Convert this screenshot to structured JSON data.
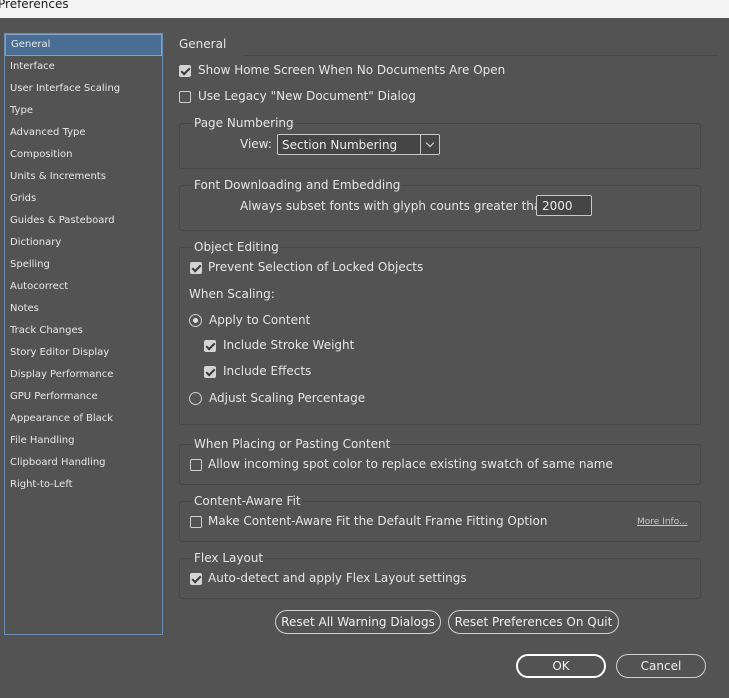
{
  "window": {
    "title": "Preferences"
  },
  "sidebar": {
    "items": [
      {
        "label": "General"
      },
      {
        "label": "Interface"
      },
      {
        "label": "User Interface Scaling"
      },
      {
        "label": "Type"
      },
      {
        "label": "Advanced Type"
      },
      {
        "label": "Composition"
      },
      {
        "label": "Units & Increments"
      },
      {
        "label": "Grids"
      },
      {
        "label": "Guides & Pasteboard"
      },
      {
        "label": "Dictionary"
      },
      {
        "label": "Spelling"
      },
      {
        "label": "Autocorrect"
      },
      {
        "label": "Notes"
      },
      {
        "label": "Track Changes"
      },
      {
        "label": "Story Editor Display"
      },
      {
        "label": "Display Performance"
      },
      {
        "label": "GPU Performance"
      },
      {
        "label": "Appearance of Black"
      },
      {
        "label": "File Handling"
      },
      {
        "label": "Clipboard Handling"
      },
      {
        "label": "Right-to-Left"
      }
    ],
    "selected": "General"
  },
  "main": {
    "title": "General",
    "show_home_screen": {
      "label": "Show Home Screen When No Documents Are Open",
      "checked": true
    },
    "legacy_new_doc": {
      "label": "Use Legacy \"New Document\" Dialog",
      "checked": false
    },
    "page_numbering": {
      "heading": "Page Numbering",
      "view_label": "View:",
      "view_value": "Section Numbering"
    },
    "font_downloading": {
      "heading": "Font Downloading and Embedding",
      "subset_label": "Always subset fonts with glyph counts greater than:",
      "subset_value": "2000"
    },
    "object_editing": {
      "heading": "Object Editing",
      "prevent_locked": {
        "label": "Prevent Selection of Locked Objects",
        "checked": true
      },
      "when_scaling_label": "When Scaling:",
      "apply_to_content": {
        "label": "Apply to Content",
        "selected": true
      },
      "include_stroke": {
        "label": "Include Stroke Weight",
        "checked": true
      },
      "include_effects": {
        "label": "Include Effects",
        "checked": true
      },
      "adjust_scaling": {
        "label": "Adjust Scaling Percentage",
        "selected": false
      }
    },
    "placing": {
      "heading": "When Placing or Pasting Content",
      "spot_color": {
        "label": "Allow incoming spot color to replace existing swatch of same name",
        "checked": false
      }
    },
    "content_aware": {
      "heading": "Content-Aware Fit",
      "default_fit": {
        "label": "Make Content-Aware Fit the Default Frame Fitting Option",
        "checked": false
      },
      "more_info": "More Info..."
    },
    "flex_layout": {
      "heading": "Flex Layout",
      "auto_detect": {
        "label": "Auto-detect and apply Flex Layout settings",
        "checked": true
      }
    },
    "reset_warnings_label": "Reset All Warning Dialogs",
    "reset_prefs_label": "Reset Preferences On Quit"
  },
  "footer": {
    "ok_label": "OK",
    "cancel_label": "Cancel"
  }
}
